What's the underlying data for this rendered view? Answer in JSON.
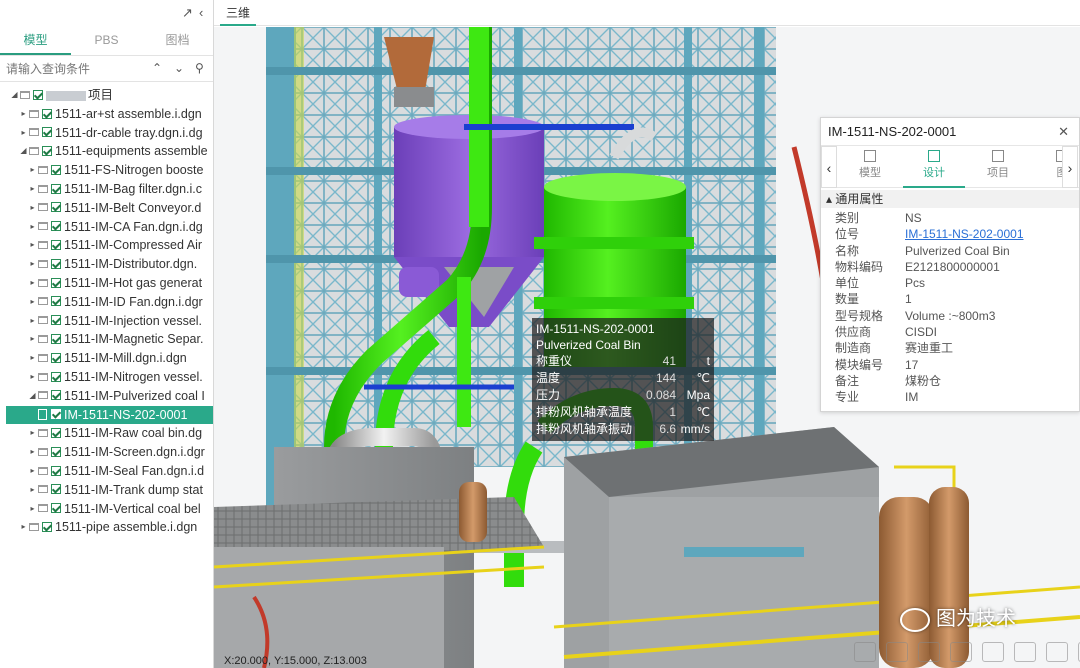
{
  "left_panel": {
    "tabs": [
      {
        "label": "模型",
        "active": true
      },
      {
        "label": "PBS",
        "active": false
      },
      {
        "label": "图档",
        "active": false
      }
    ],
    "search_placeholder": "请输入查询条件",
    "icons": {
      "pin": "pin-icon",
      "collapse": "chevron-left-icon",
      "up": "chevron-up-icon",
      "down": "chevron-down-icon",
      "search": "search-icon"
    },
    "tree": [
      {
        "level": 0,
        "expanded": true,
        "label": "项目",
        "blurred": true
      },
      {
        "level": 1,
        "expanded": false,
        "label": "1511-ar+st assemble.i.dgn"
      },
      {
        "level": 1,
        "expanded": false,
        "label": "1511-dr-cable tray.dgn.i.dg"
      },
      {
        "level": 1,
        "expanded": true,
        "label": "1511-equipments assemble"
      },
      {
        "level": 2,
        "expanded": false,
        "label": "1511-FS-Nitrogen booste"
      },
      {
        "level": 2,
        "expanded": false,
        "label": "1511-IM-Bag filter.dgn.i.c"
      },
      {
        "level": 2,
        "expanded": false,
        "label": "1511-IM-Belt Conveyor.d"
      },
      {
        "level": 2,
        "expanded": false,
        "label": "1511-IM-CA Fan.dgn.i.dg"
      },
      {
        "level": 2,
        "expanded": false,
        "label": "1511-IM-Compressed Air"
      },
      {
        "level": 2,
        "expanded": false,
        "label": "1511-IM-Distributor.dgn."
      },
      {
        "level": 2,
        "expanded": false,
        "label": "1511-IM-Hot gas generat"
      },
      {
        "level": 2,
        "expanded": false,
        "label": "1511-IM-ID Fan.dgn.i.dgr"
      },
      {
        "level": 2,
        "expanded": false,
        "label": "1511-IM-Injection vessel."
      },
      {
        "level": 2,
        "expanded": false,
        "label": "1511-IM-Magnetic Separ."
      },
      {
        "level": 2,
        "expanded": false,
        "label": "1511-IM-Mill.dgn.i.dgn"
      },
      {
        "level": 2,
        "expanded": false,
        "label": "1511-IM-Nitrogen vessel."
      },
      {
        "level": 2,
        "expanded": true,
        "label": "1511-IM-Pulverized coal I"
      },
      {
        "level": 3,
        "selected": true,
        "leaf": true,
        "label": "IM-1511-NS-202-0001"
      },
      {
        "level": 2,
        "expanded": false,
        "label": "1511-IM-Raw coal bin.dg"
      },
      {
        "level": 2,
        "expanded": false,
        "label": "1511-IM-Screen.dgn.i.dgr"
      },
      {
        "level": 2,
        "expanded": false,
        "label": "1511-IM-Seal Fan.dgn.i.d"
      },
      {
        "level": 2,
        "expanded": false,
        "label": "1511-IM-Trank dump stat"
      },
      {
        "level": 2,
        "expanded": false,
        "label": "1511-IM-Vertical coal bel"
      },
      {
        "level": 1,
        "expanded": false,
        "label": "1511-pipe assemble.i.dgn"
      }
    ]
  },
  "view": {
    "tab_label": "三维",
    "coords": "X:20.000, Y:15.000, Z:13.003"
  },
  "tooltip": {
    "id": "IM-1511-NS-202-0001",
    "name": "Pulverized Coal Bin",
    "rows": [
      {
        "label": "称重仪",
        "value": "41",
        "unit": "t"
      },
      {
        "label": "温度",
        "value": "144",
        "unit": "℃"
      },
      {
        "label": "压力",
        "value": "0.084",
        "unit": "Mpa"
      },
      {
        "label": "排粉风机轴承温度",
        "value": "1",
        "unit": "℃"
      },
      {
        "label": "排粉风机轴承振动",
        "value": "6.6",
        "unit": "mm/s"
      }
    ]
  },
  "properties": {
    "title": "IM-1511-NS-202-0001",
    "tabs": [
      {
        "label": "模型",
        "active": false,
        "icon": "cube-icon"
      },
      {
        "label": "设计",
        "active": true,
        "icon": "design-doc-icon"
      },
      {
        "label": "项目",
        "active": false,
        "icon": "project-doc-icon"
      },
      {
        "label": "图",
        "active": false,
        "icon": "drawing-icon"
      }
    ],
    "section": "通用属性",
    "rows": [
      {
        "key": "类别",
        "value": "NS",
        "link": false
      },
      {
        "key": "位号",
        "value": "IM-1511-NS-202-0001",
        "link": true
      },
      {
        "key": "名称",
        "value": "Pulverized Coal Bin",
        "link": false
      },
      {
        "key": "物料编码",
        "value": "E2121800000001",
        "link": false
      },
      {
        "key": "单位",
        "value": "Pcs",
        "link": false
      },
      {
        "key": "数量",
        "value": "1",
        "link": false
      },
      {
        "key": "型号规格",
        "value": "Volume :~800m3",
        "link": false
      },
      {
        "key": "供应商",
        "value": "CISDI",
        "link": false
      },
      {
        "key": "制造商",
        "value": "赛迪重工",
        "link": false
      },
      {
        "key": "模块编号",
        "value": "17",
        "link": false
      },
      {
        "key": "备注",
        "value": "煤粉仓",
        "link": false
      },
      {
        "key": "专业",
        "value": "IM",
        "link": false
      }
    ]
  },
  "watermark": {
    "text": "图为技术"
  },
  "colors": {
    "accent": "#2aa98a",
    "pipe_green": "#39e60e",
    "steel": "#6fb3c9",
    "vessel_purple": "#8a5ad6"
  }
}
